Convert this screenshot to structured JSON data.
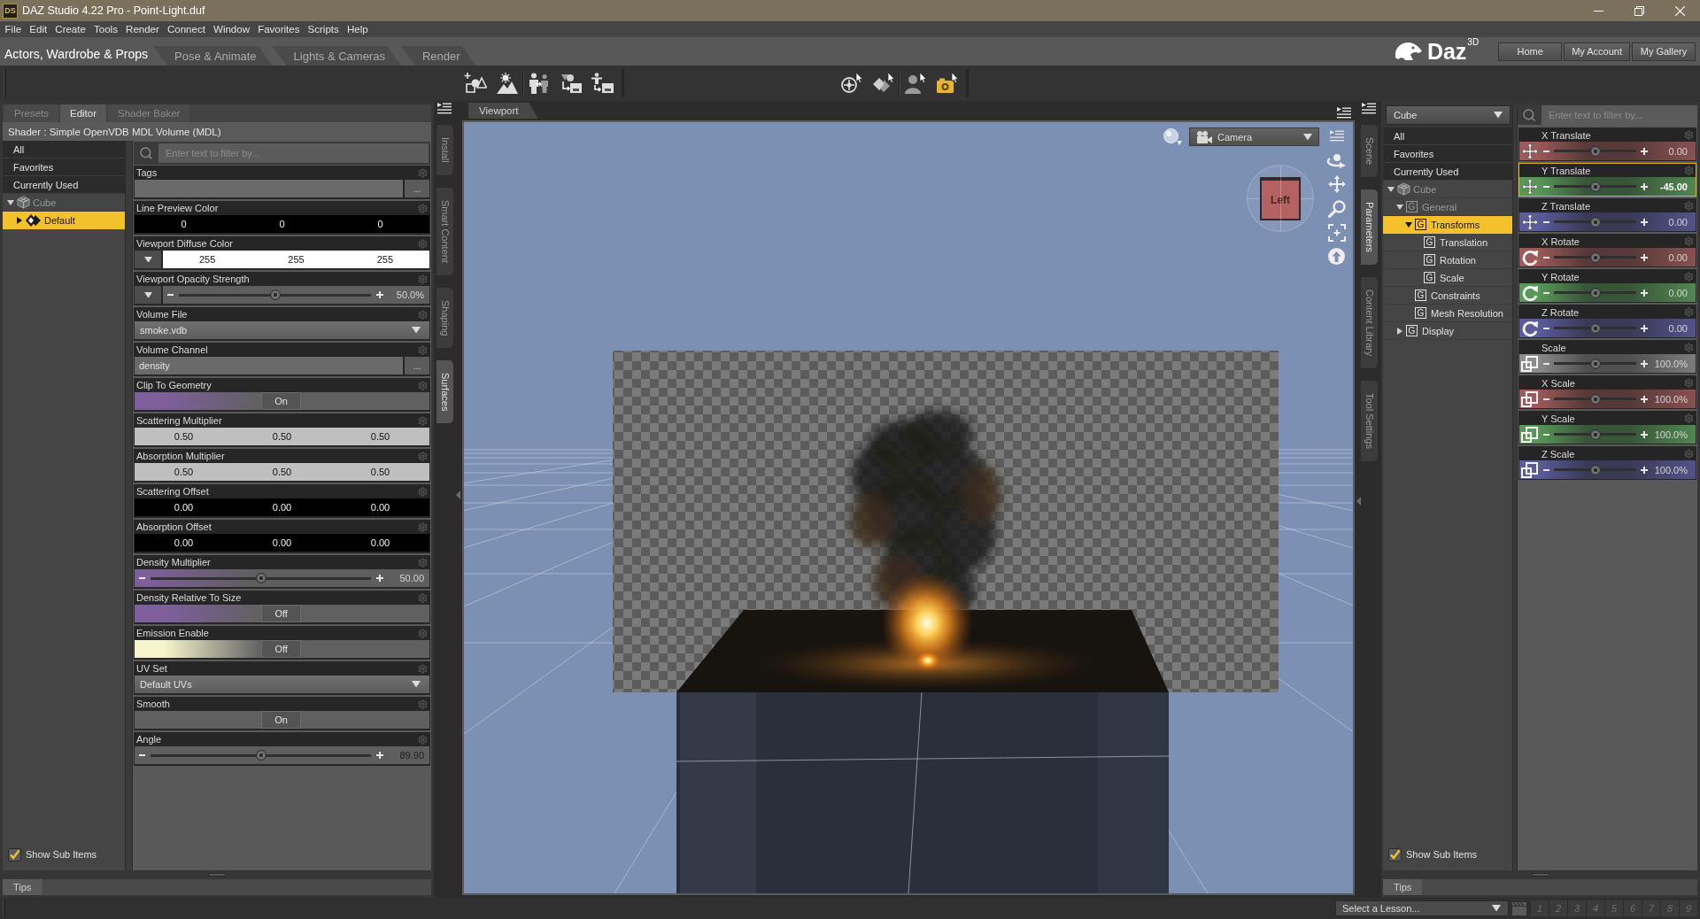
{
  "window": {
    "app_icon": "DS",
    "title": "DAZ Studio 4.22 Pro - Point-Light.duf"
  },
  "menu": [
    "File",
    "Edit",
    "Create",
    "Tools",
    "Render",
    "Connect",
    "Window",
    "Favorites",
    "Scripts",
    "Help"
  ],
  "workspace_tabs": [
    {
      "label": "Actors, Wardrobe & Props",
      "selected": true
    },
    {
      "label": "Pose & Animate",
      "selected": false
    },
    {
      "label": "Lights & Cameras",
      "selected": false
    },
    {
      "label": "Render",
      "selected": false
    }
  ],
  "brand": {
    "logo": "Daz$^{3D}$",
    "buttons": [
      "Home",
      "My Account",
      "My Gallery"
    ]
  },
  "left_panel": {
    "tabs": [
      {
        "label": "Presets",
        "selected": false
      },
      {
        "label": "Editor",
        "selected": true
      },
      {
        "label": "Shader Baker",
        "selected": false
      }
    ],
    "shader": "Shader : Simple OpenVDB MDL Volume (MDL)",
    "filters": [
      {
        "label": "All",
        "selected": false
      },
      {
        "label": "Favorites",
        "selected": false
      },
      {
        "label": "Currently Used",
        "selected": false
      }
    ],
    "tree": [
      {
        "label": "Cube",
        "kind": "cube",
        "dimmed": true,
        "expanded": true,
        "selected": false,
        "children": [
          {
            "label": "Default",
            "kind": "material",
            "dimmed": false,
            "expanded": false,
            "selected": true
          }
        ]
      }
    ],
    "show_sub_items": {
      "label": "Show Sub Items",
      "checked": true
    },
    "search": {
      "placeholder": "Enter text to filter by..."
    },
    "properties": [
      {
        "kind": "text",
        "label": "Tags",
        "button": "...",
        "disabled": false
      },
      {
        "kind": "color",
        "label": "Line Preview Color",
        "values": [
          "0",
          "0",
          "0"
        ],
        "color": "#000000",
        "collapsible": false,
        "disabled": false
      },
      {
        "kind": "color",
        "label": "Viewport Diffuse Color",
        "values": [
          "255",
          "255",
          "255"
        ],
        "color": "#ffffff",
        "collapsible": true,
        "disabled": false
      },
      {
        "kind": "slider",
        "label": "Viewport Opacity Strength",
        "level": 0.5,
        "reading": "50.0%",
        "collapsible": true,
        "disabled": false
      },
      {
        "kind": "dropdown",
        "label": "Volume File",
        "value": "smoke.vdb",
        "disabled": false
      },
      {
        "kind": "text",
        "label": "Volume Channel",
        "value": "density",
        "button": "...",
        "disabled": false
      },
      {
        "kind": "toggle",
        "label": "Clip To Geometry",
        "value": "On",
        "color": "#7e5f9c",
        "disabled": false
      },
      {
        "kind": "color",
        "label": "Scattering Multiplier",
        "values": [
          "0.50",
          "0.50",
          "0.50"
        ],
        "color": "#bfbfbf",
        "collapsible": false,
        "disabled": false
      },
      {
        "kind": "color",
        "label": "Absorption Multiplier",
        "values": [
          "0.50",
          "0.50",
          "0.50"
        ],
        "color": "#bfbfbf",
        "collapsible": false,
        "disabled": false
      },
      {
        "kind": "color",
        "label": "Scattering Offset",
        "values": [
          "0.00",
          "0.00",
          "0.00"
        ],
        "color": "#000000",
        "collapsible": false,
        "disabled": false
      },
      {
        "kind": "color",
        "label": "Absorption Offset",
        "values": [
          "0.00",
          "0.00",
          "0.00"
        ],
        "color": "#000000",
        "collapsible": false,
        "disabled": false
      },
      {
        "kind": "slider",
        "label": "Density Multiplier",
        "level": 0.5,
        "reading": "50.00",
        "color": "#7e5f9c",
        "collapsible": false,
        "disabled": false
      },
      {
        "kind": "toggle",
        "label": "Density Relative To Size",
        "value": "Off",
        "color": "#7e5f9c",
        "disabled": false
      },
      {
        "kind": "toggle",
        "label": "Emission Enable",
        "value": "Off",
        "color": "#f7f5cc",
        "disabled": false
      },
      {
        "kind": "dropdown",
        "label": "UV Set",
        "value": "Default UVs",
        "disabled": false
      },
      {
        "kind": "toggle",
        "label": "Smooth",
        "value": "On",
        "disabled": false
      },
      {
        "kind": "slider",
        "label": "Angle",
        "level": 0.5,
        "reading": "89.90",
        "collapsible": false,
        "disabled": true
      }
    ],
    "tips": "Tips"
  },
  "left_dock_tabs": [
    {
      "label": "Install",
      "selected": false
    },
    {
      "label": "Smart Content",
      "selected": false
    },
    {
      "label": "Shaping",
      "selected": false
    },
    {
      "label": "Surfaces",
      "selected": true
    }
  ],
  "viewport": {
    "tab": "Viewport",
    "camera": "Camera",
    "view_cube": "Left"
  },
  "right_dock_tabs": [
    {
      "label": "Scene",
      "selected": false
    },
    {
      "label": "Parameters",
      "selected": true
    },
    {
      "label": "Content Library",
      "selected": false
    },
    {
      "label": "Tool Settings",
      "selected": false
    }
  ],
  "scene_panel": {
    "node": "Cube",
    "filters": [
      {
        "label": "All",
        "selected": false
      },
      {
        "label": "Favorites",
        "selected": false
      },
      {
        "label": "Currently Used",
        "selected": false
      }
    ],
    "tree": [
      {
        "label": "Cube",
        "kind": "cube",
        "dimmed": true,
        "expanded": true,
        "selected": false,
        "children": [
          {
            "label": "General",
            "kind": "group",
            "badge": "G",
            "dimmed": true,
            "expanded": true,
            "selected": false,
            "children": [
              {
                "label": "Transforms",
                "kind": "group",
                "badge": "G",
                "dimmed": false,
                "expanded": true,
                "selected": true,
                "children": [
                  {
                    "label": "Translation",
                    "kind": "group",
                    "badge": "G",
                    "dimmed": false,
                    "selected": false
                  },
                  {
                    "label": "Rotation",
                    "kind": "group",
                    "badge": "G",
                    "dimmed": false,
                    "selected": false
                  },
                  {
                    "label": "Scale",
                    "kind": "group",
                    "badge": "G",
                    "dimmed": false,
                    "selected": false
                  }
                ]
              },
              {
                "label": "Constraints",
                "kind": "group",
                "badge": "G",
                "dimmed": false,
                "selected": false
              },
              {
                "label": "Mesh Resolution",
                "kind": "group",
                "badge": "G",
                "dimmed": false,
                "selected": false
              }
            ]
          },
          {
            "label": "Display",
            "kind": "group",
            "badge": "G",
            "dimmed": false,
            "expanded": false,
            "selected": false
          }
        ]
      }
    ],
    "show_sub_items": {
      "label": "Show Sub Items",
      "checked": true
    },
    "tips": "Tips"
  },
  "parameters": {
    "search": {
      "placeholder": "Enter text to filter by..."
    },
    "items": [
      {
        "label": "X Translate",
        "kind": "translate",
        "color": "#9c5a5a",
        "level": 0.5,
        "reading": "0.00",
        "selected": false,
        "modified": false
      },
      {
        "label": "Y Translate",
        "kind": "translate",
        "color": "#5a985a",
        "level": 0.5,
        "reading": "-45.00",
        "selected": true,
        "modified": true
      },
      {
        "label": "Z Translate",
        "kind": "translate",
        "color": "#5c5c9c",
        "level": 0.5,
        "reading": "0.00",
        "selected": false,
        "modified": false
      },
      {
        "label": "X Rotate",
        "kind": "rotate",
        "color": "#9c5a5a",
        "level": 0.5,
        "reading": "0.00",
        "selected": false,
        "modified": false
      },
      {
        "label": "Y Rotate",
        "kind": "rotate",
        "color": "#5a985a",
        "level": 0.5,
        "reading": "0.00",
        "selected": false,
        "modified": false
      },
      {
        "label": "Z Rotate",
        "kind": "rotate",
        "color": "#5c5c9c",
        "level": 0.5,
        "reading": "0.00",
        "selected": false,
        "modified": false
      },
      {
        "label": "Scale",
        "kind": "scale",
        "color": "#8c8c8c",
        "level": 0.5,
        "reading": "100.0%",
        "selected": false,
        "modified": false
      },
      {
        "label": "X Scale",
        "kind": "scale",
        "color": "#9c5a5a",
        "level": 0.5,
        "reading": "100.0%",
        "selected": false,
        "modified": false
      },
      {
        "label": "Y Scale",
        "kind": "scale",
        "color": "#5a985a",
        "level": 0.5,
        "reading": "100.0%",
        "selected": false,
        "modified": false
      },
      {
        "label": "Z Scale",
        "kind": "scale",
        "color": "#5c5c9c",
        "level": 0.5,
        "reading": "100.0%",
        "selected": false,
        "modified": false
      }
    ]
  },
  "status_bar": {
    "lesson": "Select a Lesson...",
    "steps": [
      "1",
      "2",
      "3",
      "4",
      "5",
      "6",
      "7",
      "8",
      "9"
    ]
  }
}
